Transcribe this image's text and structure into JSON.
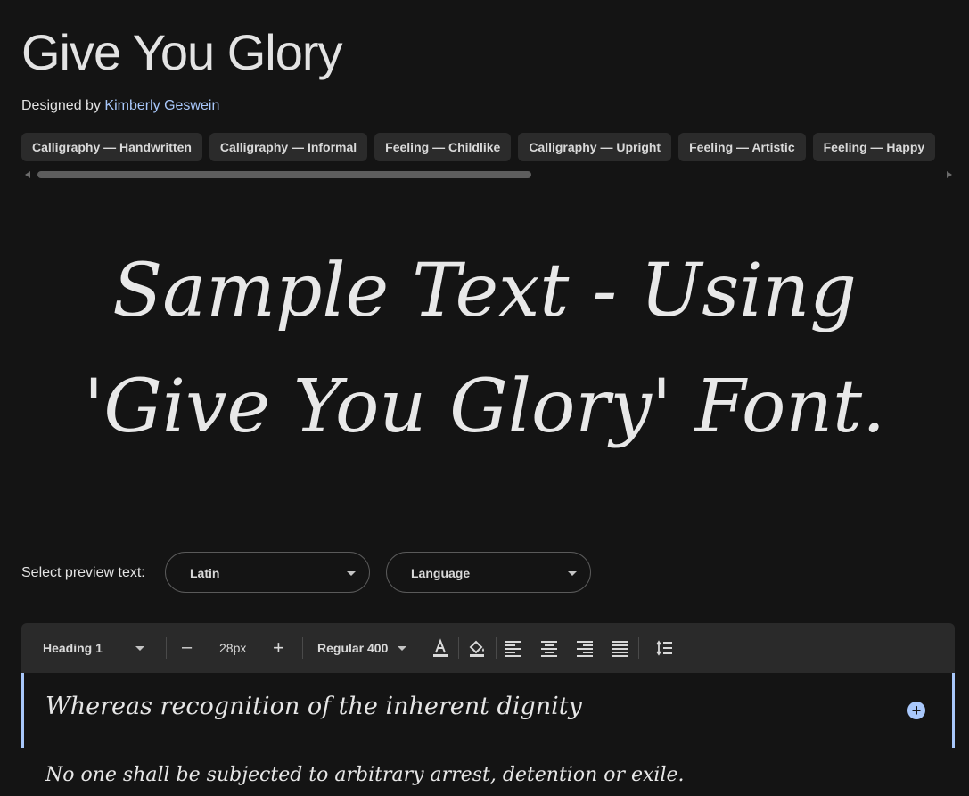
{
  "font": {
    "title": "Give You Glory",
    "designed_by_label": "Designed by",
    "designer": "Kimberly Geswein"
  },
  "tags": [
    "Calligraphy — Handwritten",
    "Calligraphy — Informal",
    "Feeling — Childlike",
    "Calligraphy — Upright",
    "Feeling — Artistic",
    "Feeling — Happy"
  ],
  "sample_text": "Sample Text - Using 'Give You Glory' Font.",
  "preview": {
    "label": "Select preview text:",
    "script_value": "Latin",
    "language_value": "Language"
  },
  "toolbar": {
    "style_value": "Heading 1",
    "decrease_label": "–",
    "size_value": "28px",
    "increase_label": "+",
    "weight_value": "Regular 400"
  },
  "editor": {
    "line1": "Whereas recognition of the inherent dignity",
    "line2": "No one shall be subjected to arbitrary arrest, detention or exile."
  },
  "colors": {
    "background": "#141414",
    "accent": "#a8c7fa",
    "toolbar": "#2a2a2a"
  },
  "icons": [
    "text-color-icon",
    "highlight-icon",
    "align-left-icon",
    "align-center-icon",
    "align-right-icon",
    "align-justify-icon",
    "line-spacing-icon",
    "add-icon"
  ]
}
